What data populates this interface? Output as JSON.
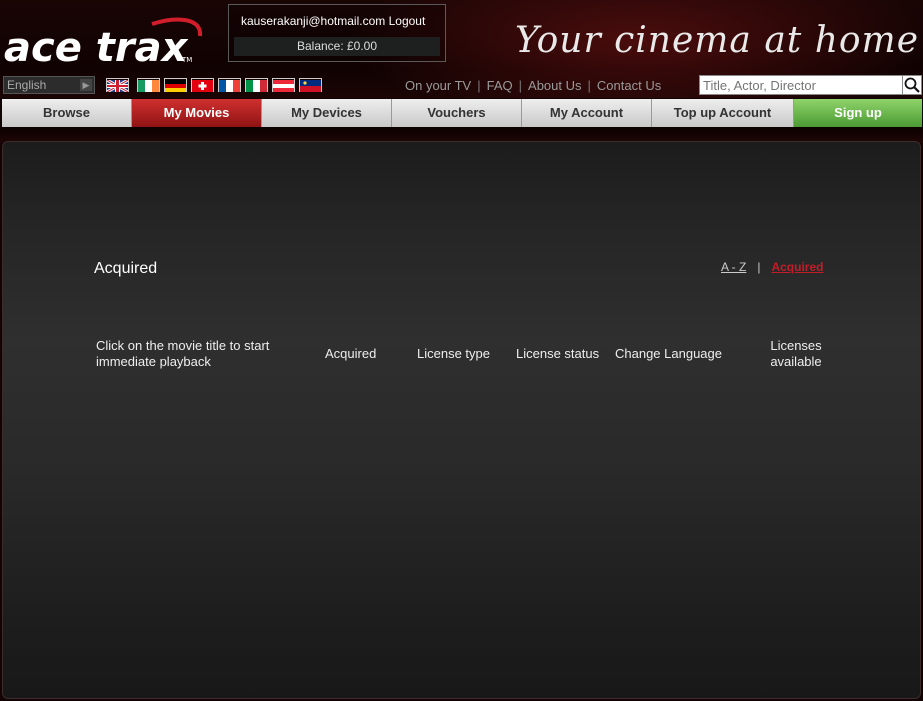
{
  "header": {
    "logo_text": "ace trax",
    "logo_tm": "TM",
    "tagline": "Your cinema at home"
  },
  "account": {
    "email": "kauserakanji@hotmail.com",
    "logout_label": "Logout",
    "balance": "Balance: £0.00"
  },
  "language": {
    "selected": "English"
  },
  "flags": [
    {
      "name": "uk-flag"
    },
    {
      "name": "ireland-flag"
    },
    {
      "name": "germany-flag"
    },
    {
      "name": "switzerland-flag"
    },
    {
      "name": "france-flag"
    },
    {
      "name": "italy-flag"
    },
    {
      "name": "austria-flag"
    },
    {
      "name": "liechtenstein-flag"
    }
  ],
  "top_links": {
    "tv": "On your TV",
    "faq": "FAQ",
    "about": "About Us",
    "contact": "Contact Us",
    "separator": "|"
  },
  "search": {
    "placeholder": "Title, Actor, Director"
  },
  "nav": {
    "browse": "Browse",
    "my_movies": "My Movies",
    "my_devices": "My Devices",
    "vouchers": "Vouchers",
    "my_account": "My Account",
    "top_up": "Top up Account",
    "sign_up": "Sign up"
  },
  "main": {
    "section_title": "Acquired",
    "sort": {
      "az": "A - Z",
      "separator": "|",
      "acquired": "Acquired"
    },
    "columns": {
      "title_line1": "Click on the movie title to start",
      "title_line2": "immediate playback",
      "acquired": "Acquired",
      "license_type": "License type",
      "license_status": "License status",
      "change_language": "Change Language",
      "licenses_line1": "Licenses",
      "licenses_line2": "available"
    }
  },
  "colors": {
    "brand_red": "#c21d28",
    "active_tab": "#b82222",
    "signup_green": "#5aaa3e"
  }
}
